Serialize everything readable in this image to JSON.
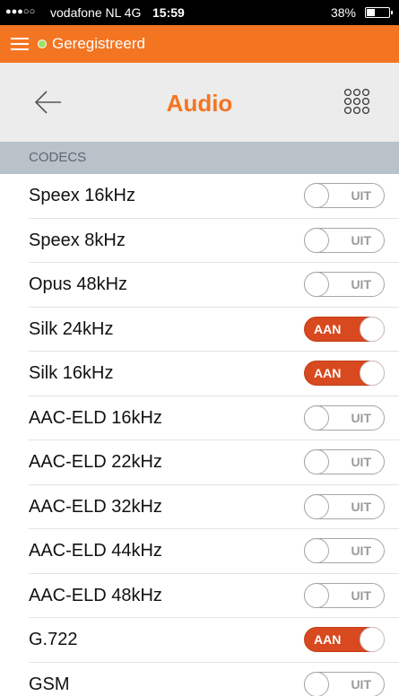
{
  "status_bar": {
    "signal": "●●●○○",
    "carrier": "vodafone NL  4G",
    "time": "15:59",
    "battery": "38%",
    "battery_level": 0.38
  },
  "registration": {
    "label": "Geregistreerd",
    "status_color": "#9be26a"
  },
  "header": {
    "title": "Audio",
    "back_icon": "arrow-left-icon",
    "grid_icon": "grid-dots-icon",
    "accent_color": "#f47521"
  },
  "section": {
    "label": "CODECS"
  },
  "toggle_labels": {
    "on": "AAN",
    "off": "UIT"
  },
  "codecs": [
    {
      "name": "Speex 16kHz",
      "enabled": false
    },
    {
      "name": "Speex 8kHz",
      "enabled": false
    },
    {
      "name": "Opus 48kHz",
      "enabled": false
    },
    {
      "name": "Silk 24kHz",
      "enabled": true
    },
    {
      "name": "Silk 16kHz",
      "enabled": true
    },
    {
      "name": "AAC-ELD 16kHz",
      "enabled": false
    },
    {
      "name": "AAC-ELD 22kHz",
      "enabled": false
    },
    {
      "name": "AAC-ELD 32kHz",
      "enabled": false
    },
    {
      "name": "AAC-ELD 44kHz",
      "enabled": false
    },
    {
      "name": "AAC-ELD 48kHz",
      "enabled": false
    },
    {
      "name": "G.722",
      "enabled": true
    },
    {
      "name": "GSM",
      "enabled": false
    }
  ]
}
